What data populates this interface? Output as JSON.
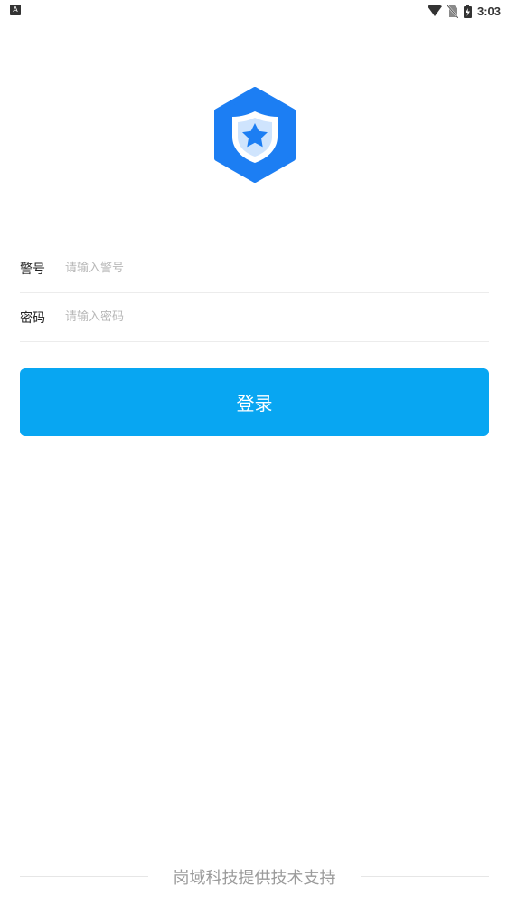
{
  "status_bar": {
    "time": "3:03",
    "left_icon": "a-notification-icon",
    "icons": [
      "wifi-icon",
      "no-sim-icon",
      "battery-charging-icon"
    ]
  },
  "logo": {
    "icon": "shield-star-icon",
    "color": "#1c7ef3"
  },
  "form": {
    "badge": {
      "label": "警号",
      "placeholder": "请输入警号",
      "value": ""
    },
    "password": {
      "label": "密码",
      "placeholder": "请输入密码",
      "value": ""
    }
  },
  "login_button": {
    "label": "登录",
    "color": "#08a6f2"
  },
  "footer": {
    "text": "岗域科技提供技术支持"
  }
}
